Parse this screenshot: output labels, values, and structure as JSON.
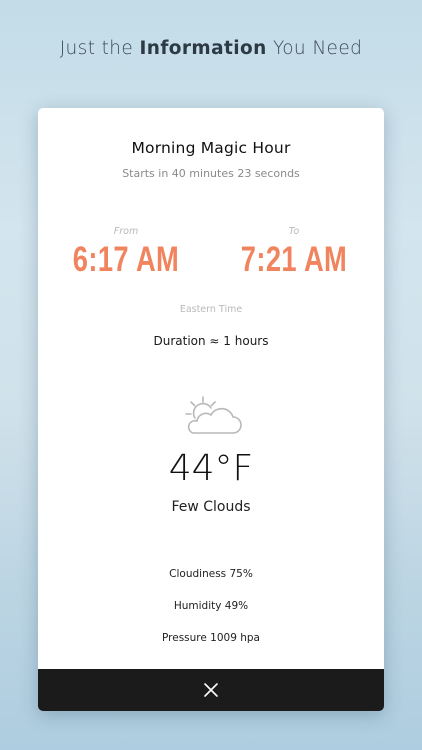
{
  "headline": {
    "prefix": "Just the ",
    "bold": "Information",
    "suffix": " You Need"
  },
  "card": {
    "title": "Morning Magic Hour",
    "subtitle": "Starts in 40 minutes 23 seconds",
    "from_label": "From",
    "from_time": "6:17 AM",
    "to_label": "To",
    "to_time": "7:21 AM",
    "timezone": "Eastern Time",
    "duration": "Duration ≈ 1 hours",
    "weather": {
      "icon": "partly-cloudy-icon",
      "temperature": "44°F",
      "condition": "Few Clouds",
      "cloudiness": "Cloudiness 75%",
      "humidity": "Humidity 49%",
      "pressure": "Pressure 1009 hpa"
    }
  },
  "footer": {
    "close_icon": "close-icon"
  },
  "colors": {
    "accent": "#f0845e",
    "footer_bg": "#1b1b1b"
  }
}
